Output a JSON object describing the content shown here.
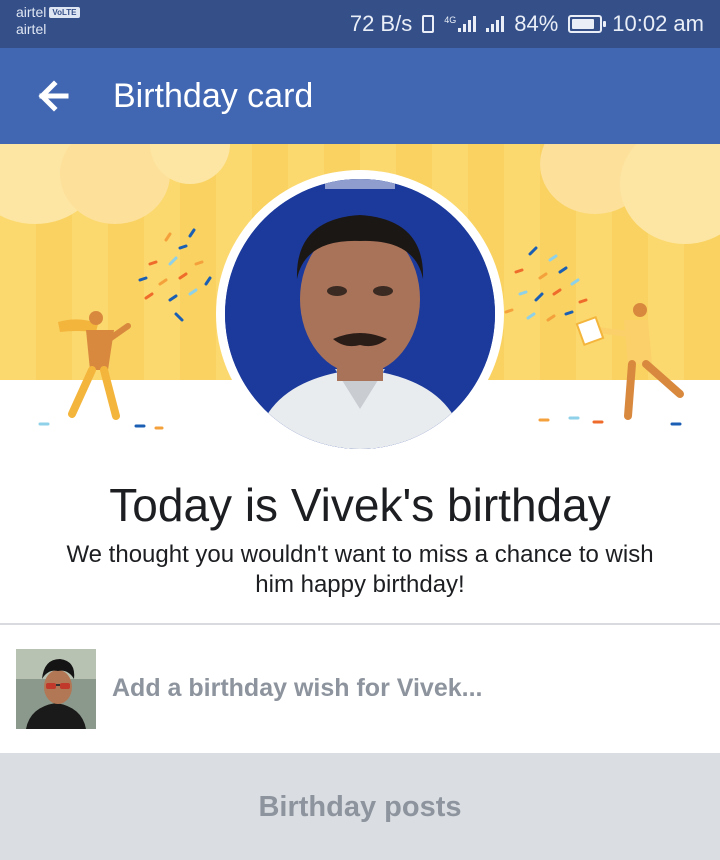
{
  "status_bar": {
    "carrier_primary": "airtel",
    "carrier_badge": "VoLTE",
    "carrier_secondary": "airtel",
    "network_speed": "72 B/s",
    "network_type": "4G",
    "battery": "84%",
    "battery_level": 0.84,
    "time": "10:02 am",
    "icons": [
      "vibrate-icon",
      "signal-icon",
      "signal-icon",
      "battery-icon"
    ]
  },
  "app_bar": {
    "back_icon": "arrow-left-icon",
    "title": "Birthday card",
    "color": "#4267b2"
  },
  "card": {
    "headline": "Today is Vivek's birthday",
    "subtext": "We thought you wouldn't want to miss a chance to wish him happy birthday!"
  },
  "composer": {
    "placeholder": "Add a birthday wish for Vivek..."
  },
  "section": {
    "title": "Birthday posts"
  }
}
